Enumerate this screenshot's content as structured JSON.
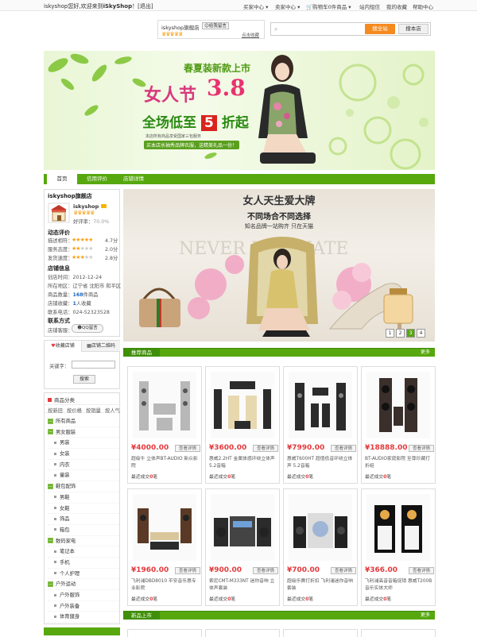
{
  "topbar": {
    "welcome_prefix": "iskyshop您好,欢迎来到",
    "welcome_brand": "iSkyShop",
    "welcome_suffix": "！[退出]",
    "links": [
      "买家中心",
      "卖家中心",
      "购物车0件商品",
      "站内短信",
      "我的收藏",
      "帮助中心"
    ]
  },
  "shop_card": {
    "name": "iskyshop旗舰店",
    "message_button": "给我留言",
    "enter_link": "点击收藏"
  },
  "search": {
    "placeholder": "",
    "search_all_label": "搜全站",
    "search_shop_label": "搜本店"
  },
  "banner": {
    "headline": "春夏装新款上市",
    "event": "女人节",
    "date": "3.8",
    "discount_prefix": "全场低至",
    "discount_value": "5",
    "discount_suffix": "折起",
    "subline_1": "本店所有商品享受国家三包服务",
    "subline_2": "买本店水袖秀品牌衣服，送精美礼品一份！"
  },
  "main_nav": [
    "首页",
    "信用评价",
    "店铺详情"
  ],
  "shop_info": {
    "title": "iskyshop旗舰店",
    "owner": "iskyshop",
    "praise_label": "好评率：",
    "praise_value": "70.0%",
    "rating_title": "动态评价",
    "ratings": [
      {
        "label": "描述相符：",
        "score": "4.7分",
        "stars": 5
      },
      {
        "label": "服务态度：",
        "score": "2.0分",
        "stars": 2
      },
      {
        "label": "发货速度：",
        "score": "2.8分",
        "stars": 3
      }
    ],
    "info_title": "店铺信息",
    "info_rows": [
      {
        "label": "创店时间：",
        "value": "2012-12-24"
      },
      {
        "label": "所在地区：",
        "value": "辽宁省 沈阳市 和平区"
      },
      {
        "label": "商品数量：",
        "value": "168",
        "suffix": "件商品"
      },
      {
        "label": "店铺收藏：",
        "value": "1",
        "suffix": "人收藏"
      },
      {
        "label": "联系电话：",
        "value": "024-52323528"
      }
    ],
    "contact_title": "联系方式",
    "contact_label": "店铺客服：",
    "qq_label": "QQ留言"
  },
  "side_tabs": [
    "收藏店铺",
    "店铺二维码"
  ],
  "keyword": {
    "label": "关键字：",
    "value": "",
    "button": "搜索"
  },
  "categories": {
    "title": "商品分类",
    "sort_tabs": [
      "按新旧",
      "按价格",
      "按销量",
      "按人气"
    ],
    "items": [
      {
        "label": "所有商品",
        "level": 1
      },
      {
        "label": "男女服装",
        "level": 1
      },
      {
        "label": "男装",
        "level": 2
      },
      {
        "label": "女装",
        "level": 2
      },
      {
        "label": "内衣",
        "level": 2
      },
      {
        "label": "童装",
        "level": 2
      },
      {
        "label": "鞋包配饰",
        "level": 1
      },
      {
        "label": "男鞋",
        "level": 2
      },
      {
        "label": "女鞋",
        "level": 2
      },
      {
        "label": "饰品",
        "level": 2
      },
      {
        "label": "箱包",
        "level": 2
      },
      {
        "label": "数码家电",
        "level": 1
      },
      {
        "label": "笔记本",
        "level": 2
      },
      {
        "label": "手机",
        "level": 2
      },
      {
        "label": "个人护理",
        "level": 2
      },
      {
        "label": "户外运动",
        "level": 1
      },
      {
        "label": "户外服饰",
        "level": 2
      },
      {
        "label": "户外装备",
        "level": 2
      },
      {
        "label": "体育健身",
        "level": 2
      }
    ]
  },
  "slider": {
    "headline": "女人天生爱大牌",
    "subline": "不同场合不同选择",
    "tagline": "知名品牌一站购齐  只在天猫",
    "bg_text": "NEVER          ULTIMATE",
    "pages": [
      "1",
      "2",
      "3",
      "4"
    ],
    "active_page": 3
  },
  "recommend": {
    "title": "推荐商品",
    "more": "更多",
    "products": [
      {
        "price": "¥4000.00",
        "detail": "查看详情",
        "name": "超级牛 立体声BT-AUDIO 新众影院",
        "sold_label": "最近成交",
        "sold": "0",
        "sold_unit": "笔"
      },
      {
        "price": "¥3600.00",
        "detail": "查看详情",
        "name": "惠威2.2HT 金属体感环绕立体声 5.2音箱",
        "sold_label": "最近成交",
        "sold": "0",
        "sold_unit": "笔"
      },
      {
        "price": "¥7990.00",
        "detail": "查看详情",
        "name": "惠威T600HT 超值低音环绕立体声 5.2音箱",
        "sold_label": "最近成交",
        "sold": "0",
        "sold_unit": "笔"
      },
      {
        "price": "¥18888.00",
        "detail": "查看详情",
        "name": "BT-AUDIO家庭影院 至尊珍藏打折组",
        "sold_label": "最近成交",
        "sold": "0",
        "sold_unit": "笔"
      },
      {
        "price": "¥1960.00",
        "detail": "查看详情",
        "name": "飞利浦DBD8010 平安音乐惠专业影院",
        "sold_label": "最近成交",
        "sold": "0",
        "sold_unit": "笔"
      },
      {
        "price": "¥900.00",
        "detail": "查看详情",
        "name": "索尼CMT-M333NT 迷你音响 立体声套装",
        "sold_label": "最近成交",
        "sold": "0",
        "sold_unit": "笔"
      },
      {
        "price": "¥700.00",
        "detail": "查看详情",
        "name": "超级乐赛打折扣 飞利浦迷你音响套装",
        "sold_label": "最近成交",
        "sold": "0",
        "sold_unit": "笔"
      },
      {
        "price": "¥366.00",
        "detail": "查看详情",
        "name": "飞利浦高音音箱促销 惠威T200B 音乐实体大师",
        "sold_label": "最近成交",
        "sold": "0",
        "sold_unit": "笔"
      }
    ]
  },
  "new_arrivals": {
    "title": "新品上市",
    "more": "更多"
  },
  "colors": {
    "brand_green": "#57a80f",
    "price_red": "#e4393c",
    "accent_orange": "#f58a1f"
  }
}
